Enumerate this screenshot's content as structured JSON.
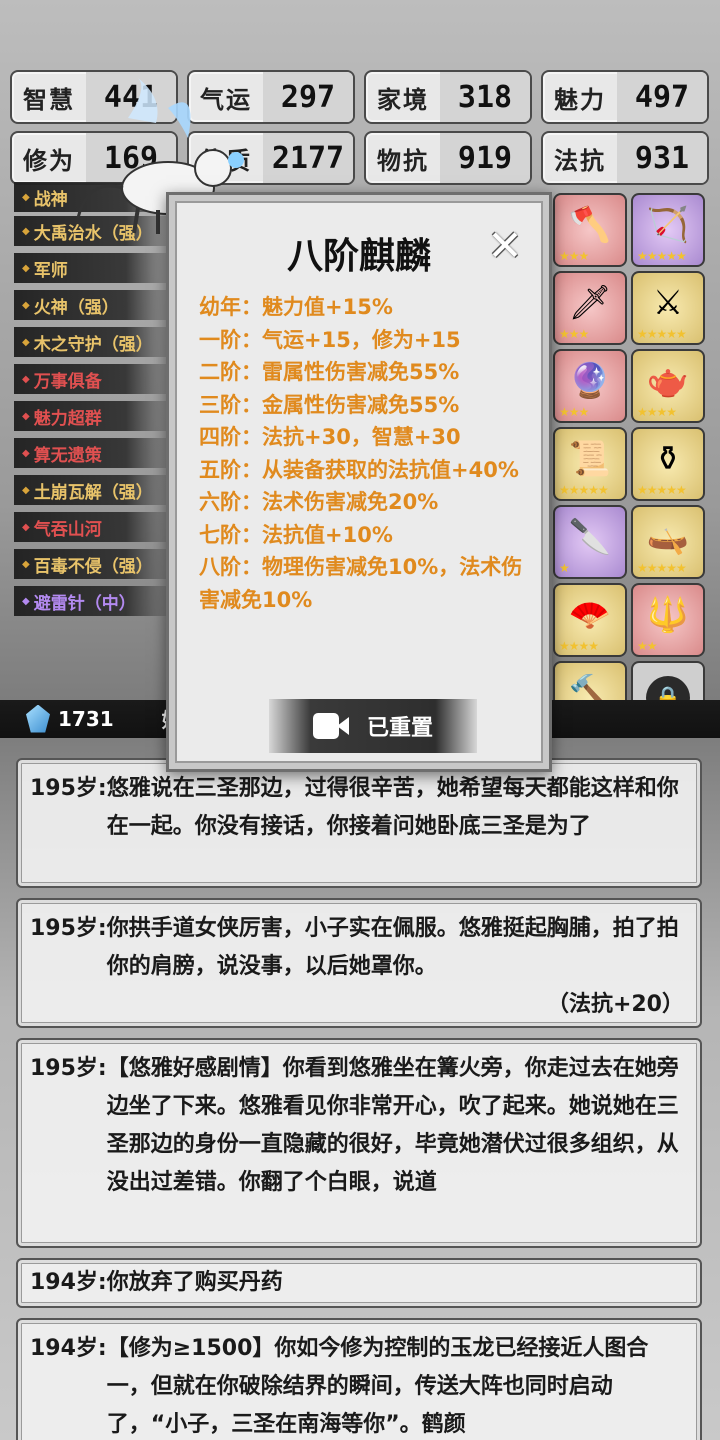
{
  "stats": [
    {
      "label": "智慧",
      "value": "441"
    },
    {
      "label": "气运",
      "value": "297"
    },
    {
      "label": "家境",
      "value": "318"
    },
    {
      "label": "魅力",
      "value": "497"
    },
    {
      "label": "修为",
      "value": "169"
    },
    {
      "label": "体质",
      "value": "2177"
    },
    {
      "label": "物抗",
      "value": "919"
    },
    {
      "label": "法抗",
      "value": "931"
    }
  ],
  "talents": [
    {
      "label": "战神",
      "color": "gold"
    },
    {
      "label": "大禹治水（强）",
      "color": "gold"
    },
    {
      "label": "军师",
      "color": "gold"
    },
    {
      "label": "火神（强）",
      "color": "gold"
    },
    {
      "label": "木之守护（强）",
      "color": "gold"
    },
    {
      "label": "万事俱备",
      "color": "red"
    },
    {
      "label": "魅力超群",
      "color": "red"
    },
    {
      "label": "算无遗策",
      "color": "red"
    },
    {
      "label": "土崩瓦解（强）",
      "color": "gold"
    },
    {
      "label": "气吞山河",
      "color": "red"
    },
    {
      "label": "百毒不侵（强）",
      "color": "gold"
    },
    {
      "label": "避雷针（中）",
      "color": "purple"
    }
  ],
  "items": [
    {
      "icon": "axe-icon",
      "glyph": "🪓",
      "bg": "red",
      "stars": "★★★"
    },
    {
      "icon": "bow-icon",
      "glyph": "🏹",
      "bg": "purple",
      "stars": "★★★★★"
    },
    {
      "icon": "sword-icon",
      "glyph": "🗡",
      "bg": "red",
      "stars": "★★★"
    },
    {
      "icon": "blade-icon",
      "glyph": "⚔",
      "bg": "gold",
      "stars": "★★★★★"
    },
    {
      "icon": "mirror-icon",
      "glyph": "🔮",
      "bg": "red",
      "stars": "★★★"
    },
    {
      "icon": "teapot-icon",
      "glyph": "🫖",
      "bg": "gold",
      "stars": "★★★★"
    },
    {
      "icon": "scroll-icon",
      "glyph": "📜",
      "bg": "gold",
      "stars": "★★★★★"
    },
    {
      "icon": "cauldron-icon",
      "glyph": "⚱",
      "bg": "gold",
      "stars": "★★★★★"
    },
    {
      "icon": "dagger-icon",
      "glyph": "🔪",
      "bg": "purple",
      "stars": "★"
    },
    {
      "icon": "boat-icon",
      "glyph": "🛶",
      "bg": "gold",
      "stars": "★★★★★"
    },
    {
      "icon": "fan-icon",
      "glyph": "🪭",
      "bg": "gold",
      "stars": "★★★★"
    },
    {
      "icon": "spear-icon",
      "glyph": "🔱",
      "bg": "red",
      "stars": "★★"
    },
    {
      "icon": "hammer-icon",
      "glyph": "🔨",
      "bg": "gold",
      "stars": "★"
    }
  ],
  "currency": {
    "value": "1731",
    "suffix": "始"
  },
  "modal": {
    "title": "八阶麒麟",
    "levels": [
      "幼年：魅力值+15%",
      "一阶：气运+15，修为+15",
      "二阶：雷属性伤害减免55%",
      "三阶：金属性伤害减免55%",
      "四阶：法抗+30，智慧+30",
      "五阶：从装备获取的法抗值+40%",
      "六阶：法术伤害减免20%",
      "七阶：法抗值+10%",
      "八阶：物理伤害减免10%，法术伤害减免10%"
    ],
    "button_label": "已重置"
  },
  "logs": [
    {
      "age": "195岁:",
      "text": "悠雅说在三圣那边，过得很辛苦，她希望每天都能这样和你在一起。你没有接话，你接着问她卧底三圣是为了",
      "extra": ""
    },
    {
      "age": "195岁:",
      "text": "你拱手道女侠厉害，小子实在佩服。悠雅挺起胸脯，拍了拍你的肩膀，说没事，以后她罩你。",
      "extra": "（法抗+20）"
    },
    {
      "age": "195岁:",
      "text": "【悠雅好感剧情】你看到悠雅坐在篝火旁，你走过去在她旁边坐了下来。悠雅看见你非常开心，吹了起来。她说她在三圣那边的身份一直隐藏的很好，毕竟她潜伏过很多组织，从没出过差错。你翻了个白眼，说道",
      "extra": ""
    },
    {
      "age": "194岁:",
      "text": "你放弃了购买丹药",
      "extra": ""
    },
    {
      "age": "194岁:",
      "text": "【修为≥1500】你如今修为控制的玉龙已经接近人图合一，但就在你破除结界的瞬间，传送大阵也同时启动了，“小子，三圣在南海等你”。鹤颜",
      "extra": ""
    }
  ]
}
